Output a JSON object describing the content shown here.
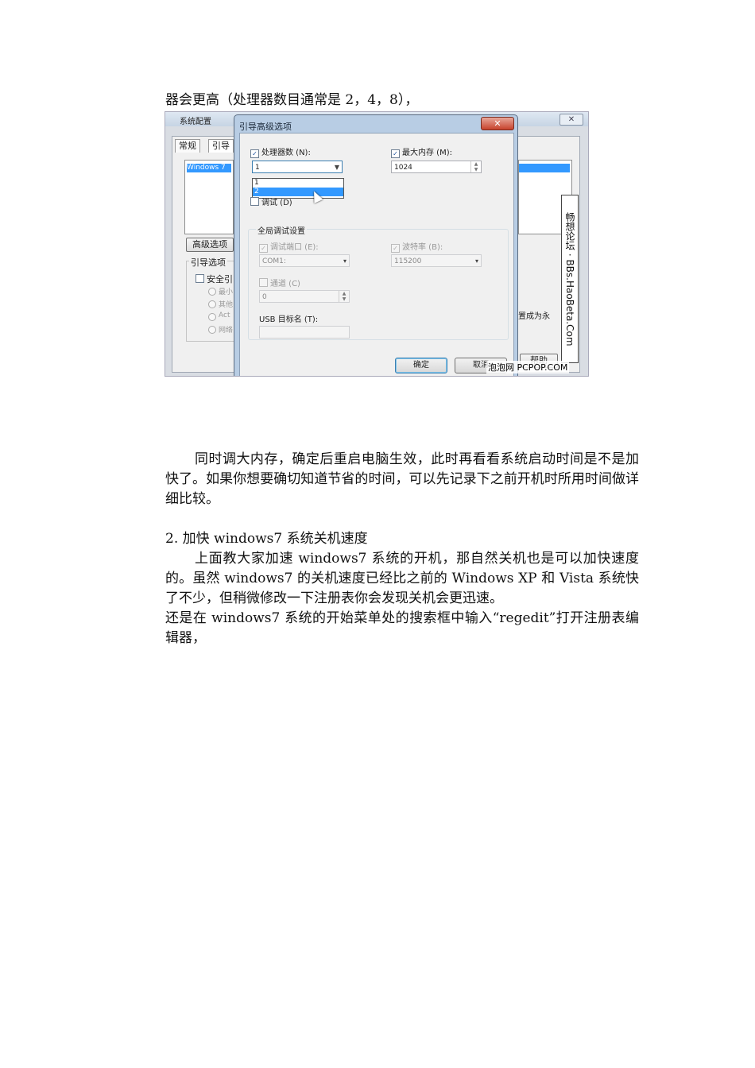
{
  "top_line": "器会更高（处理器数目通常是 2，4，8），",
  "figure": {
    "bg_window": {
      "title": "系统配置",
      "close": "✕",
      "tabs": [
        "常规",
        "引导"
      ],
      "list_item": "Windows 7",
      "advanced_button": "高级选项",
      "boot_group": "引导选项",
      "safe_boot": "安全引",
      "radios": [
        "最小",
        "其他",
        "Act",
        "网络"
      ],
      "side_text": "置成为永",
      "help_button": "帮助"
    },
    "dialog": {
      "title": "引导高级选项",
      "close": "✕",
      "processors_label": "处理器数 (N):",
      "processors_value": "1",
      "processors_options": [
        "1",
        "2"
      ],
      "max_memory_label": "最大内存 (M):",
      "max_memory_value": "1024",
      "debug_label": "调试 (D)",
      "global_group": "全局调试设置",
      "debug_port_label": "调试端口 (E):",
      "debug_port_value": "COM1:",
      "baud_label": "波特率 (B):",
      "baud_value": "115200",
      "channel_label": "通道 (C)",
      "channel_value": "0",
      "usb_label": "USB 目标名 (T):",
      "ok_button": "确定",
      "cancel_button": "取消"
    },
    "watermark": "畅想论坛 · BBs.HaoBeta.Com",
    "source": "泡泡网 PCPOP.COM"
  },
  "para1": "同时调大内存，确定后重启电脑生效，此时再看看系统启动时间是不是加快了。如果你想要确切知道节省的时间，可以先记录下之前开机时所用时间做详细比较。",
  "heading2": "2.  加快 windows7 系统关机速度",
  "para2": "上面教大家加速 windows7 系统的开机，那自然关机也是可以加快速度的。虽然 windows7 的关机速度已经比之前的 Windows XP 和 Vista 系统快了不少，但稍微修改一下注册表你会发现关机会更迅速。",
  "para3": "还是在 windows7 系统的开始菜单处的搜索框中输入“regedit”打开注册表编辑器，"
}
